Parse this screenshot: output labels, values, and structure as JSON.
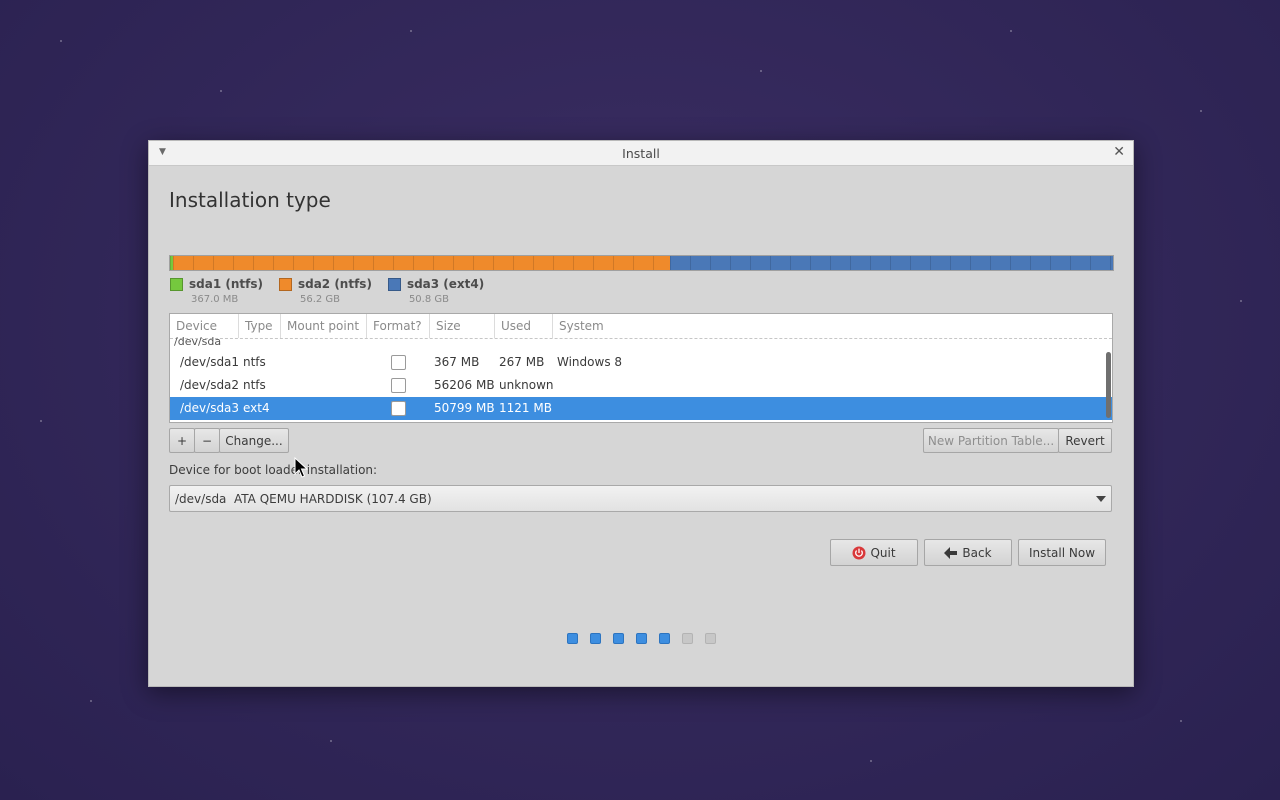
{
  "window": {
    "title": "Install"
  },
  "page": {
    "heading": "Installation type"
  },
  "disk_bar": {
    "segments": [
      {
        "name": "sda1 (ntfs)",
        "size": "367.0 MB",
        "color": "#75c83e",
        "fraction": 0.0034,
        "used_fraction": 0.73
      },
      {
        "name": "sda2 (ntfs)",
        "size": "56.2 GB",
        "color": "#ef8a2b",
        "fraction": 0.5266,
        "used_fraction": 1.0
      },
      {
        "name": "sda3 (ext4)",
        "size": "50.8 GB",
        "color": "#4a78b7",
        "fraction": 0.47,
        "used_fraction": 1.0
      }
    ]
  },
  "table": {
    "headers": [
      "Device",
      "Type",
      "Mount point",
      "Format?",
      "Size",
      "Used",
      "System"
    ],
    "disk": "/dev/sda",
    "rows": [
      {
        "device": "/dev/sda1",
        "type": "ntfs",
        "mount": "",
        "format": false,
        "size": "367 MB",
        "used": "267 MB",
        "system": "Windows 8",
        "selected": false
      },
      {
        "device": "/dev/sda2",
        "type": "ntfs",
        "mount": "",
        "format": false,
        "size": "56206 MB",
        "used": "unknown",
        "system": "",
        "selected": false
      },
      {
        "device": "/dev/sda3",
        "type": "ext4",
        "mount": "",
        "format": false,
        "size": "50799 MB",
        "used": "1121 MB",
        "system": "",
        "selected": true
      }
    ]
  },
  "buttons": {
    "add": "+",
    "remove": "−",
    "change": "Change...",
    "new_table": "New Partition Table...",
    "revert": "Revert",
    "quit": "Quit",
    "back": "Back",
    "install": "Install Now"
  },
  "boot_loader": {
    "label": "Device for boot loader installation:",
    "device": "/dev/sda",
    "description": "ATA QEMU HARDDISK (107.4 GB)"
  },
  "progress": {
    "total_steps": 7,
    "completed_steps": 5
  },
  "colors": {
    "accent": "#3d8ee0",
    "quit_icon": "#d9383a"
  }
}
